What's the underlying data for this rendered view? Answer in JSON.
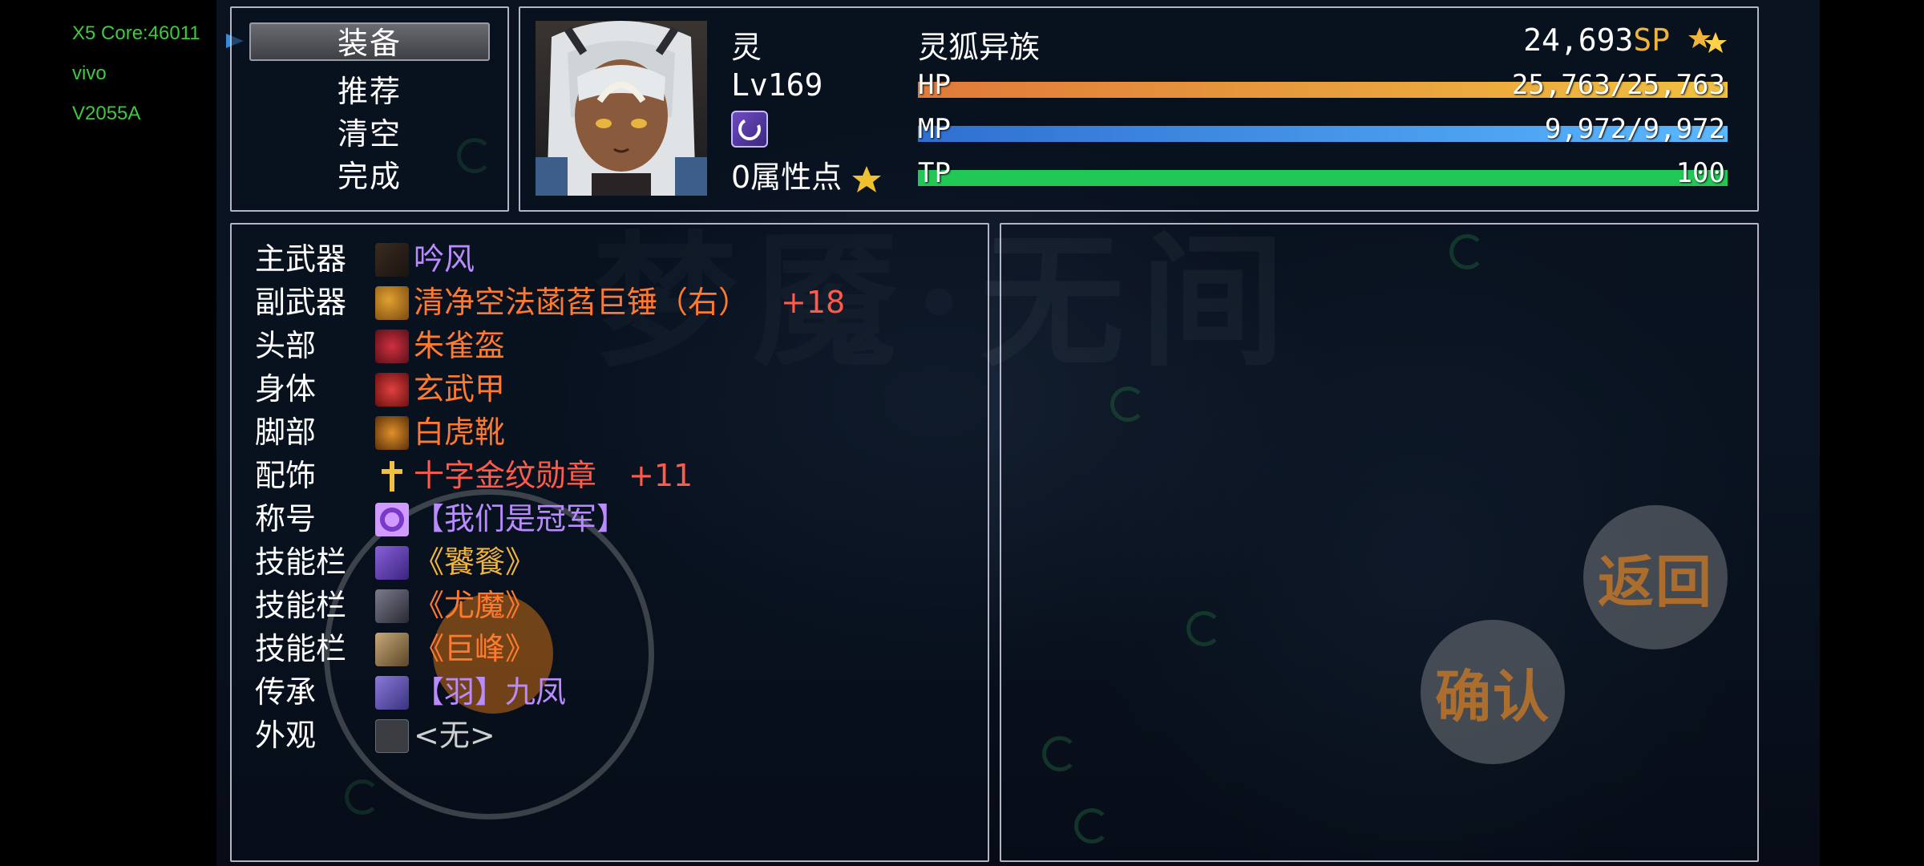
{
  "debug": {
    "core": "X5 Core:46011",
    "brand": "vivo",
    "model": "V2055A"
  },
  "menu": {
    "items": [
      "装备",
      "推荐",
      "清空",
      "完成"
    ],
    "selected_index": 0
  },
  "character": {
    "name": "灵",
    "race": "灵狐异族",
    "level": "Lv169",
    "sp": "24,693",
    "sp_unit": "SP",
    "attr_points": "0属性点",
    "hp_label": "HP",
    "hp_value": "25,763/25,763",
    "hp_fill": 1.0,
    "mp_label": "MP",
    "mp_value": "9,972/9,972",
    "mp_fill": 1.0,
    "tp_label": "TP",
    "tp_value": "100",
    "tp_fill": 1.0
  },
  "equipment": [
    {
      "slot": "主武器",
      "item": "吟风",
      "plus": "",
      "color": "#b98bff",
      "icon": "bow-icon"
    },
    {
      "slot": "副武器",
      "item": "清净空法菡萏巨锤（右）",
      "plus": "+18",
      "color": "#ff7a2e",
      "icon": "hammer-icon"
    },
    {
      "slot": "头部",
      "item": "朱雀盔",
      "plus": "",
      "color": "#ff7a2e",
      "icon": "helmet-icon"
    },
    {
      "slot": "身体",
      "item": "玄武甲",
      "plus": "",
      "color": "#ff7a2e",
      "icon": "armor-icon"
    },
    {
      "slot": "脚部",
      "item": "白虎靴",
      "plus": "",
      "color": "#ff7a2e",
      "icon": "boots-icon"
    },
    {
      "slot": "配饰",
      "item": "十字金纹勋章",
      "plus": "+11",
      "color": "#ff5a4a",
      "icon": "cross-medal-icon"
    },
    {
      "slot": "称号",
      "item": "【我们是冠军】",
      "plus": "",
      "color": "#b98bff",
      "icon": "title-icon"
    },
    {
      "slot": "技能栏",
      "item": "《饕餮》",
      "plus": "",
      "color": "#f0b43a",
      "icon": "skill-taotie-icon"
    },
    {
      "slot": "技能栏",
      "item": "《尤魔》",
      "plus": "",
      "color": "#ff7a2e",
      "icon": "skill-youmo-icon"
    },
    {
      "slot": "技能栏",
      "item": "《巨峰》",
      "plus": "",
      "color": "#ff7a2e",
      "icon": "skill-jufeng-icon"
    },
    {
      "slot": "传承",
      "item": "【羽】九凤",
      "plus": "",
      "color": "#b98bff",
      "icon": "inherit-icon"
    },
    {
      "slot": "外观",
      "item": "<无>",
      "plus": "",
      "color": "#cfcfcf",
      "icon": "empty-slot-icon"
    }
  ],
  "buttons": {
    "back": "返回",
    "confirm": "确认"
  },
  "colors": {
    "hp_start": "#e07a3a",
    "hp_end": "#f0c040",
    "mp_start": "#2f6fd0",
    "mp_end": "#5ab8ff",
    "tp": "#22c855",
    "gold": "#f0b43a"
  }
}
